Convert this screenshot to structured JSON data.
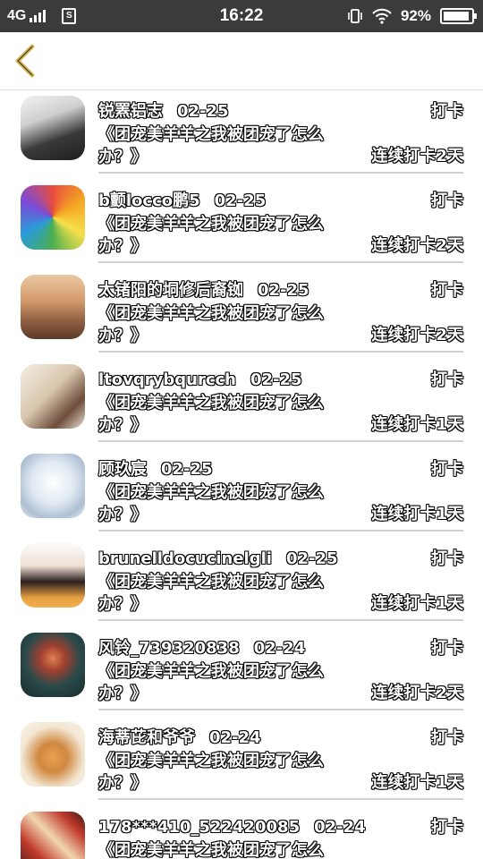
{
  "status_bar": {
    "network": "4G",
    "time": "16:22",
    "battery_text": "92%",
    "battery_level": 0.92,
    "icons": [
      "signal-icon",
      "sim-icon",
      "vibrate-icon",
      "wifi-icon",
      "battery-icon"
    ]
  },
  "nav": {
    "back_icon": "chevron-left-icon",
    "accent_color": "#d7b34a"
  },
  "items": [
    {
      "name": "锐罴铝志",
      "date": "02-25",
      "action": "打卡",
      "title": "《团宠美羊羊之我被团宠了怎么办？》",
      "streak": "连续打卡2天"
    },
    {
      "name": "b颤locco鹏5",
      "date": "02-25",
      "action": "打卡",
      "title": "《团宠美羊羊之我被团宠了怎么办？》",
      "streak": "连续打卡2天"
    },
    {
      "name": "太锗阳的垌修后裔铷",
      "date": "02-25",
      "action": "打卡",
      "title": "《团宠美羊羊之我被团宠了怎么办？》",
      "streak": "连续打卡2天"
    },
    {
      "name": "ltovqrybqurcch",
      "date": "02-25",
      "action": "打卡",
      "title": "《团宠美羊羊之我被团宠了怎么办？》",
      "streak": "连续打卡1天"
    },
    {
      "name": "顾玖宸",
      "date": "02-25",
      "action": "打卡",
      "title": "《团宠美羊羊之我被团宠了怎么办？》",
      "streak": "连续打卡1天"
    },
    {
      "name": "brunelldocucinelgli",
      "date": "02-25",
      "action": "打卡",
      "title": "《团宠美羊羊之我被团宠了怎么办？》",
      "streak": "连续打卡1天"
    },
    {
      "name": "风铃_739320838",
      "date": "02-24",
      "action": "打卡",
      "title": "《团宠美羊羊之我被团宠了怎么办？》",
      "streak": "连续打卡2天"
    },
    {
      "name": "海蒂芘和爷爷",
      "date": "02-24",
      "action": "打卡",
      "title": "《团宠美羊羊之我被团宠了怎么办？》",
      "streak": "连续打卡1天"
    },
    {
      "name": "178***410_522420085",
      "date": "02-24",
      "action": "打卡",
      "title": "《团宠美羊羊之我被团宠了怎么办？》",
      "streak": ""
    }
  ]
}
